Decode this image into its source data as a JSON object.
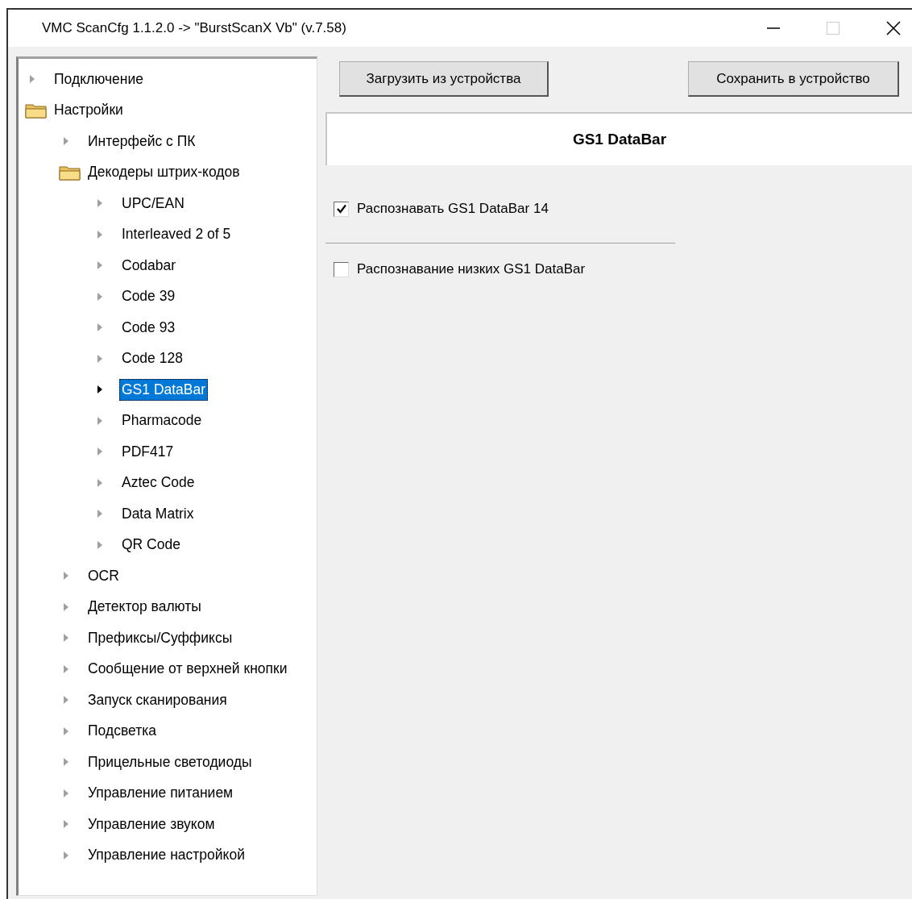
{
  "window": {
    "title": "VMC ScanCfg 1.1.2.0 -> \"BurstScanX Vb\" (v.7.58)"
  },
  "tree": [
    {
      "label": "Подключение",
      "expanded": false,
      "selected": false
    },
    {
      "label": "Настройки",
      "expanded": true,
      "selected": false,
      "children": [
        {
          "label": "Интерфейс с ПК",
          "expanded": false,
          "selected": false
        },
        {
          "label": "Декодеры штрих-кодов",
          "expanded": true,
          "selected": false,
          "children": [
            {
              "label": "UPC/EAN",
              "expanded": false,
              "selected": false
            },
            {
              "label": "Interleaved 2 of 5",
              "expanded": false,
              "selected": false
            },
            {
              "label": "Codabar",
              "expanded": false,
              "selected": false
            },
            {
              "label": "Code 39",
              "expanded": false,
              "selected": false
            },
            {
              "label": "Code 93",
              "expanded": false,
              "selected": false
            },
            {
              "label": "Code 128",
              "expanded": false,
              "selected": false
            },
            {
              "label": "GS1 DataBar",
              "expanded": false,
              "selected": true
            },
            {
              "label": "Pharmacode",
              "expanded": false,
              "selected": false
            },
            {
              "label": "PDF417",
              "expanded": false,
              "selected": false
            },
            {
              "label": "Aztec Code",
              "expanded": false,
              "selected": false
            },
            {
              "label": "Data Matrix",
              "expanded": false,
              "selected": false
            },
            {
              "label": "QR Code",
              "expanded": false,
              "selected": false
            }
          ]
        },
        {
          "label": "OCR",
          "expanded": false,
          "selected": false
        },
        {
          "label": "Детектор валюты",
          "expanded": false,
          "selected": false
        },
        {
          "label": "Префиксы/Суффиксы",
          "expanded": false,
          "selected": false
        },
        {
          "label": "Сообщение от верхней кнопки",
          "expanded": false,
          "selected": false
        },
        {
          "label": "Запуск сканирования",
          "expanded": false,
          "selected": false
        },
        {
          "label": "Подсветка",
          "expanded": false,
          "selected": false
        },
        {
          "label": "Прицельные светодиоды",
          "expanded": false,
          "selected": false
        },
        {
          "label": "Управление питанием",
          "expanded": false,
          "selected": false
        },
        {
          "label": "Управление звуком",
          "expanded": false,
          "selected": false
        },
        {
          "label": "Управление настройкой",
          "expanded": false,
          "selected": false
        }
      ]
    }
  ],
  "buttons": [
    "Загрузить из устройства",
    "Сохранить в устройство"
  ],
  "panel": {
    "title": "GS1 DataBar",
    "options": [
      {
        "label": "Распознавать GS1 DataBar 14",
        "checked": true
      },
      {
        "label": "Распознавание низких GS1 DataBar",
        "checked": false
      }
    ]
  }
}
